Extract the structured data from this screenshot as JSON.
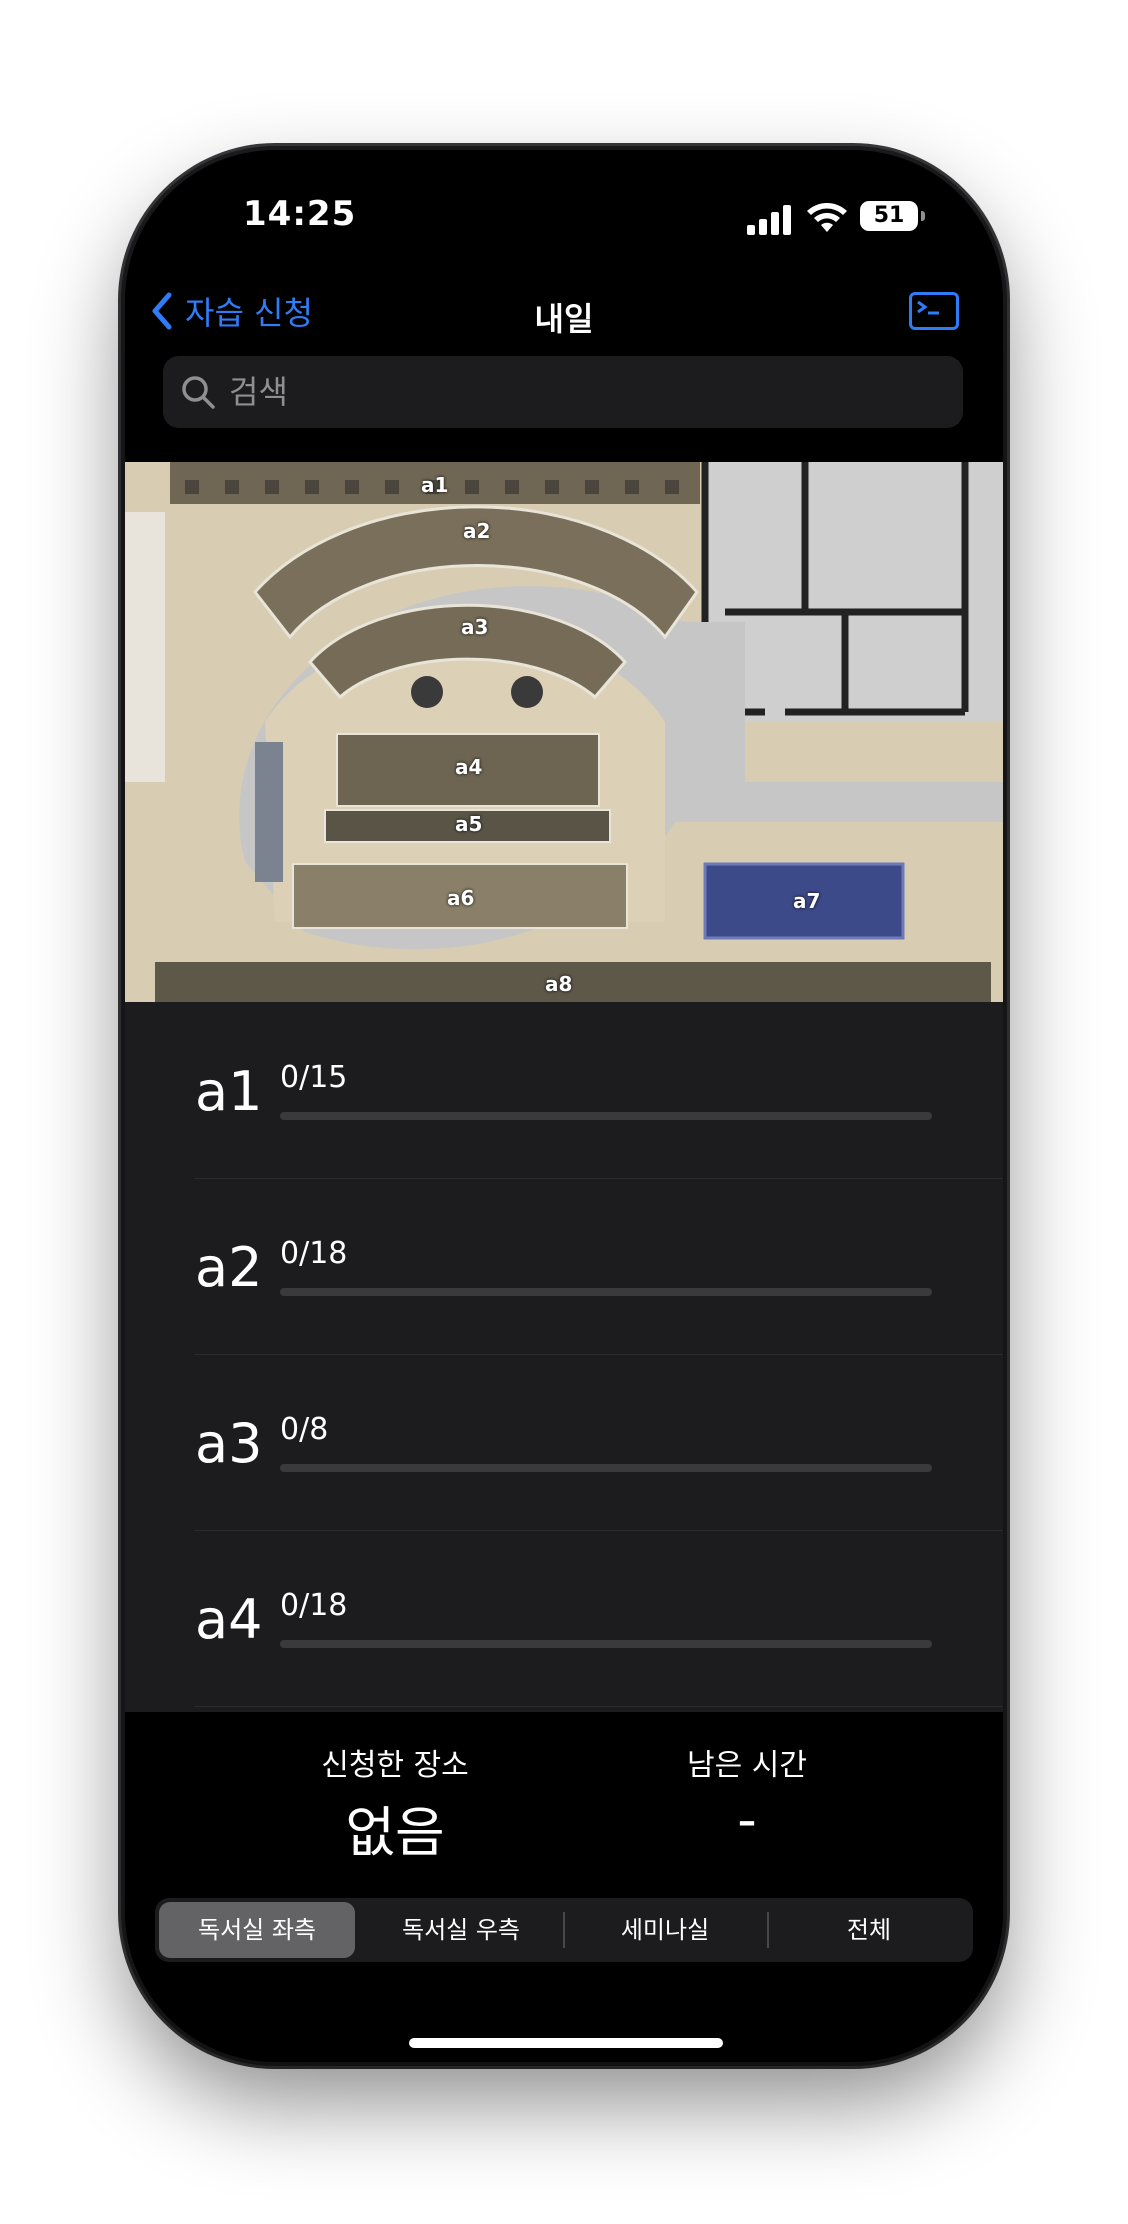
{
  "status": {
    "time": "14:25",
    "battery": "51"
  },
  "nav": {
    "back_label": "자습 신청",
    "title": "내일"
  },
  "search": {
    "placeholder": "검색"
  },
  "floorplan": {
    "zones": [
      "a1",
      "a2",
      "a3",
      "a4",
      "a5",
      "a6",
      "a7",
      "a8"
    ]
  },
  "rooms": [
    {
      "name": "a1",
      "count": "0/15",
      "fill": 0
    },
    {
      "name": "a2",
      "count": "0/18",
      "fill": 0
    },
    {
      "name": "a3",
      "count": "0/8",
      "fill": 0
    },
    {
      "name": "a4",
      "count": "0/18",
      "fill": 0
    }
  ],
  "summary": {
    "place_label": "신청한 장소",
    "place_value": "없음",
    "time_label": "남은 시간",
    "time_value": "-"
  },
  "segments": {
    "s0": "독서실 좌측",
    "s1": "독서실 우측",
    "s2": "세미나실",
    "s3": "전체"
  },
  "colors": {
    "accent": "#2f7cf6",
    "background": "#000000",
    "list_bg": "#1c1c1e"
  }
}
